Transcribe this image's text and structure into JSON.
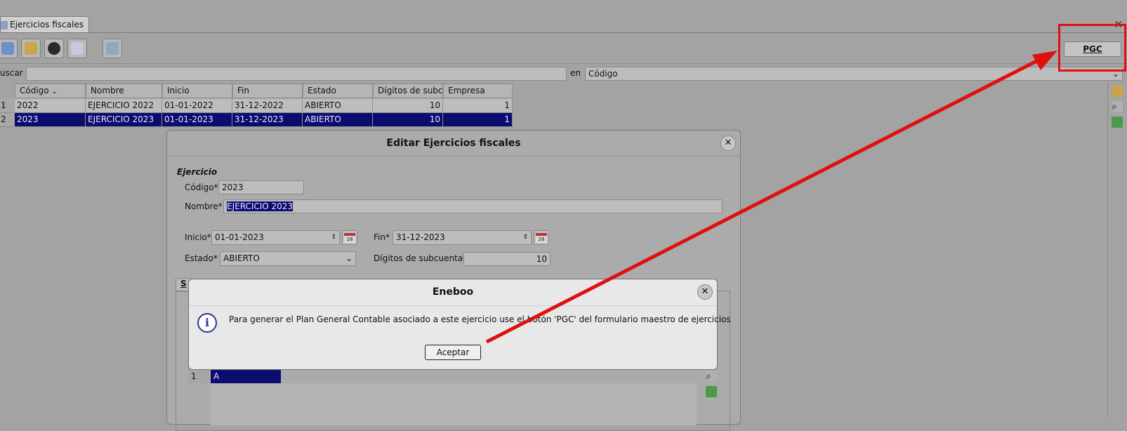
{
  "window": {
    "tab_label": "Ejercicios fiscales"
  },
  "toolbar": {
    "buttons": [
      "new-record-icon",
      "edit-record-icon",
      "delete-record-icon",
      "save-record-icon",
      "print-icon"
    ],
    "pgc_label": "PGC"
  },
  "search": {
    "label": "uscar",
    "value": "",
    "in_label": "en",
    "field_value": "Código"
  },
  "table": {
    "columns": [
      "Código",
      "Nombre",
      "Inicio",
      "Fin",
      "Estado",
      "Dígitos de subcu",
      "Empresa"
    ],
    "rows": [
      {
        "num": "1",
        "codigo": "2022",
        "nombre": "EJERCICIO 2022",
        "inicio": "01-01-2022",
        "fin": "31-12-2022",
        "estado": "ABIERTO",
        "digitos": "10",
        "empresa": "1"
      },
      {
        "num": "2",
        "codigo": "2023",
        "nombre": "EJERCICIO 2023",
        "inicio": "01-01-2023",
        "fin": "31-12-2023",
        "estado": "ABIERTO",
        "digitos": "10",
        "empresa": "1"
      }
    ]
  },
  "edit_dialog": {
    "title": "Editar Ejercicios fiscales",
    "group_label": "Ejercicio",
    "codigo_label": "Código*",
    "codigo_value": "2023",
    "nombre_label": "Nombre*",
    "nombre_value": "EJERCICIO 2023",
    "inicio_label": "Inicio*",
    "inicio_value": "01-01-2023",
    "fin_label": "Fin*",
    "fin_value": "31-12-2023",
    "estado_label": "Estado*",
    "estado_value": "ABIERTO",
    "digitos_label": "Dígitos de subcuenta*",
    "digitos_value": "10",
    "sub_tab_label": "S",
    "sub_row_num": "1",
    "sub_row_value": "A"
  },
  "message_box": {
    "title": "Eneboo",
    "text": "Para generar el Plan General Contable asociado a este ejercicio use el botón 'PGC' del formulario maestro de ejercicios",
    "ok_label": "Aceptar"
  },
  "colors": {
    "selection": "#0c0c6f",
    "annotation": "#e01010"
  }
}
